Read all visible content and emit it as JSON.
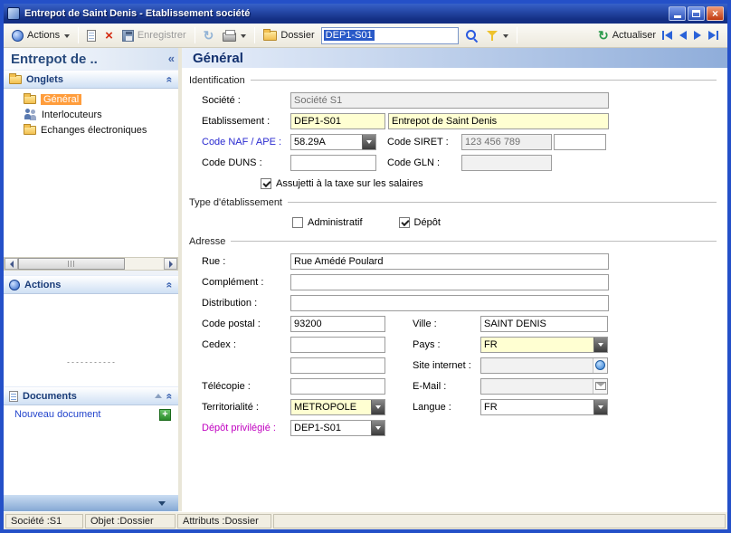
{
  "window": {
    "title": "Entrepot de Saint Denis - Etablissement société",
    "statusbar": {
      "societe": "Société :S1",
      "objet": "Objet :Dossier",
      "attributs": "Attributs :Dossier"
    }
  },
  "toolbar": {
    "actions": "Actions",
    "enregistrer": "Enregistrer",
    "dossier": "Dossier",
    "search_value": "DEP1-S01",
    "actualiser": "Actualiser"
  },
  "sidebar": {
    "header": "Entrepot de ..",
    "onglets_title": "Onglets",
    "tree": [
      "Général",
      "Interlocuteurs",
      "Echanges électroniques"
    ],
    "actions_title": "Actions",
    "documents_title": "Documents",
    "nouveau_document": "Nouveau document"
  },
  "main": {
    "header": "Général",
    "identification": {
      "title": "Identification",
      "societe_label": "Société :",
      "societe_value": "Société S1",
      "etablissement_label": "Etablissement :",
      "etablissement_code": "DEP1-S01",
      "etablissement_nom": "Entrepot de Saint Denis",
      "naf_label": "Code NAF / APE :",
      "naf_value": "58.29A",
      "siret_label": "Code SIRET :",
      "siret_value": "123 456 789",
      "duns_label": "Code DUNS :",
      "gln_label": "Code GLN :",
      "taxe_label": "Assujetti à la taxe sur les salaires"
    },
    "type": {
      "title": "Type d'établissement",
      "administratif_label": "Administratif",
      "depot_label": "Dépôt"
    },
    "adresse": {
      "title": "Adresse",
      "rue_label": "Rue :",
      "rue_value": "Rue Amédé Poulard",
      "complement_label": "Complément :",
      "distribution_label": "Distribution :",
      "code_postal_label": "Code postal :",
      "code_postal_value": "93200",
      "ville_label": "Ville :",
      "ville_value": "SAINT DENIS",
      "cedex_label": "Cedex :",
      "pays_label": "Pays :",
      "pays_value": "FR",
      "site_label": "Site internet :",
      "telecopie_label": "Télécopie :",
      "email_label": "E-Mail :",
      "territorialite_label": "Territorialité :",
      "territorialite_value": "METROPOLE",
      "langue_label": "Langue :",
      "langue_value": "FR",
      "depot_privilegie_label": "Dépôt privilégié :",
      "depot_privilegie_value": "DEP1-S01"
    }
  }
}
